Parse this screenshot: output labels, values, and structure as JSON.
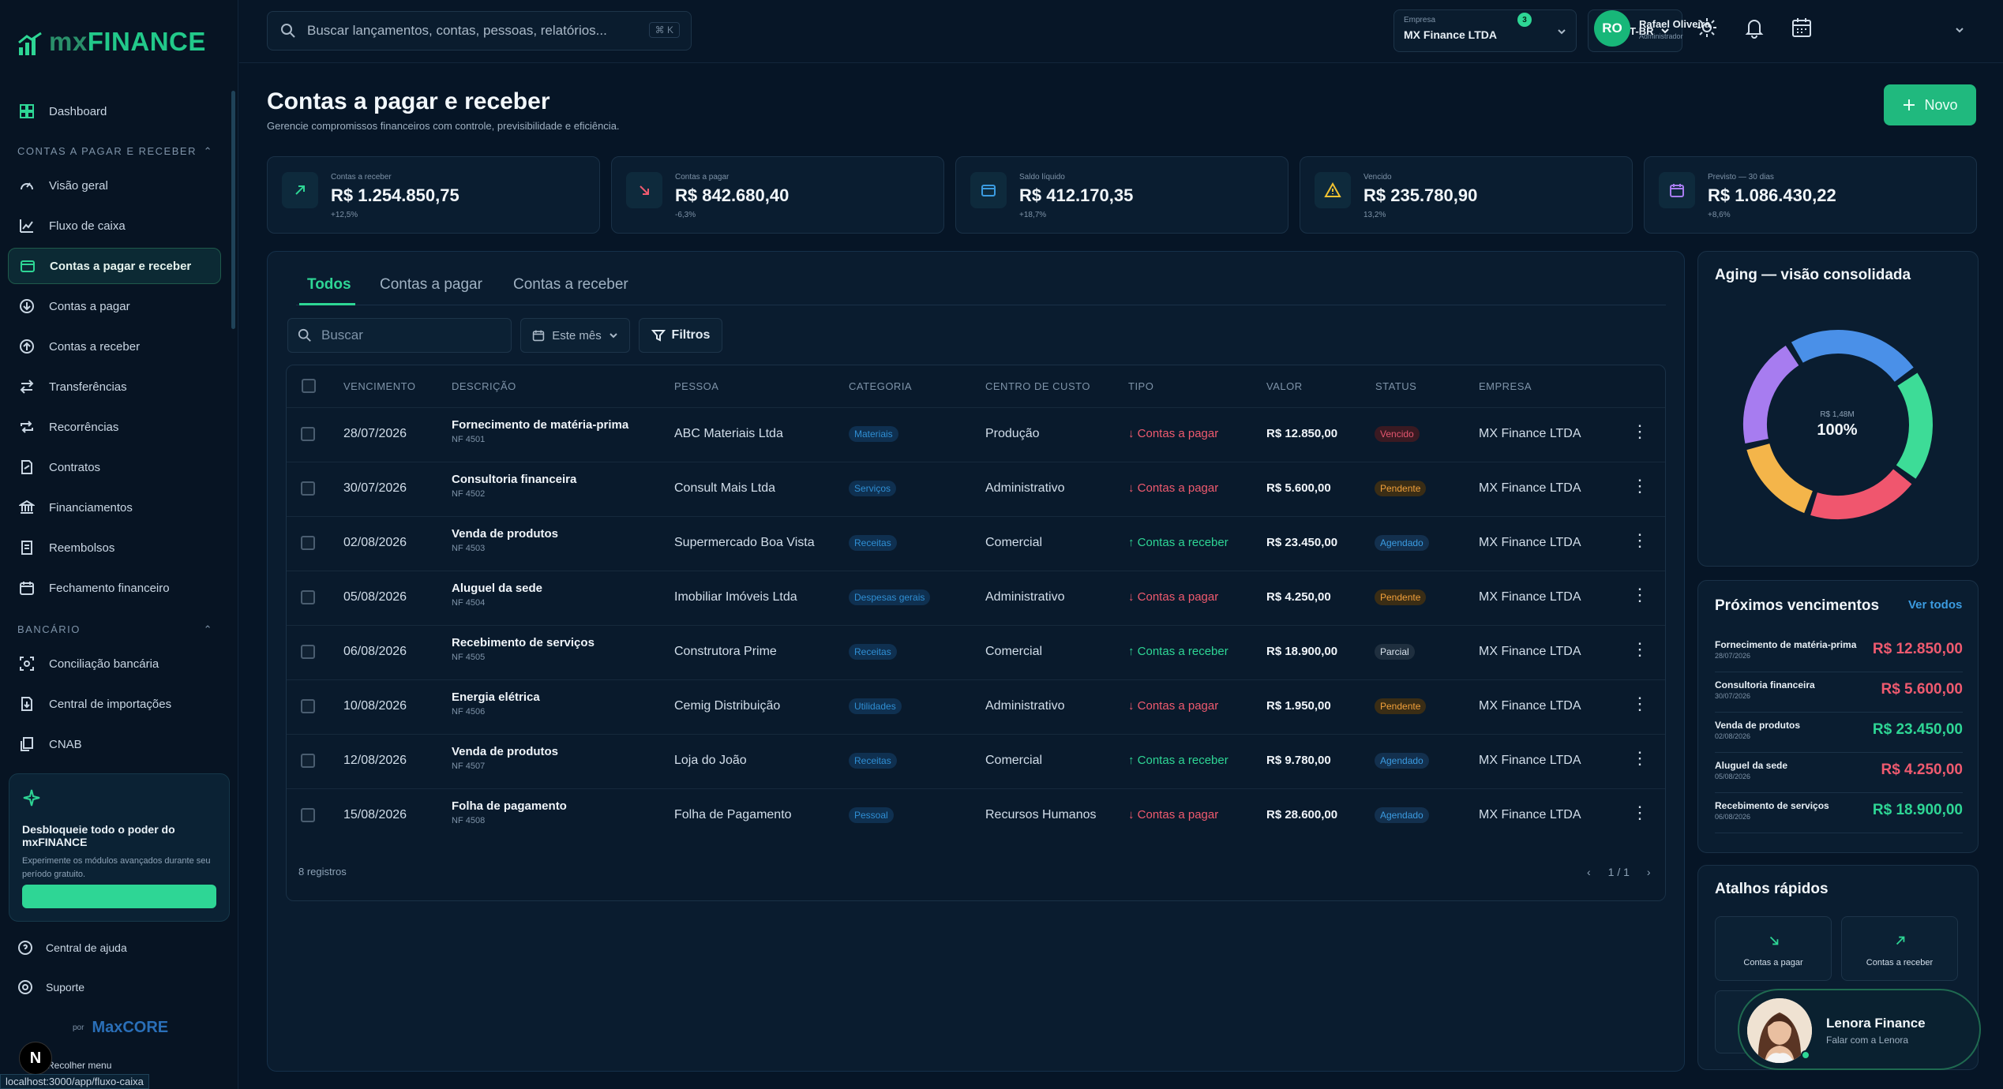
{
  "brand": {
    "logo_prefix": "mx",
    "logo_main": "FINANCE",
    "accent": "#2ed695"
  },
  "search": {
    "placeholder": "Buscar lançamentos, contas, pessoas, relatórios...",
    "shortcut": "⌘ K"
  },
  "topbar": {
    "company_label": "Empresa",
    "company_value": "MX Finance LTDA",
    "language": "PT-BR",
    "notification_count": "3",
    "user_initials": "RO",
    "user_name": "Rafael Oliveira",
    "user_role": "Administrador"
  },
  "sidebar": {
    "dashboard": "Dashboard",
    "section_contas": "CONTAS A PAGAR E RECEBER",
    "items": [
      {
        "label": "Visão geral",
        "icon": "gauge-icon"
      },
      {
        "label": "Fluxo de caixa",
        "icon": "chart-line-icon"
      },
      {
        "label": "Contas a pagar e receber",
        "icon": "wallet-icon",
        "active": true
      },
      {
        "label": "Contas a pagar",
        "icon": "arrow-down-circle-icon"
      },
      {
        "label": "Contas a receber",
        "icon": "arrow-up-circle-icon"
      },
      {
        "label": "Transferências",
        "icon": "transfer-icon"
      },
      {
        "label": "Recorrências",
        "icon": "repeat-icon"
      },
      {
        "label": "Contratos",
        "icon": "contract-icon"
      },
      {
        "label": "Financiamentos",
        "icon": "bank-icon"
      },
      {
        "label": "Reembolsos",
        "icon": "receipt-icon"
      },
      {
        "label": "Fechamento financeiro",
        "icon": "calendar-check-icon"
      }
    ],
    "section_bancario": "BANCÁRIO",
    "bank_items": [
      {
        "label": "Conciliação bancária",
        "icon": "scan-icon"
      },
      {
        "label": "Central de importações",
        "icon": "file-import-icon"
      },
      {
        "label": "CNAB",
        "icon": "files-icon"
      }
    ],
    "promo_title": "Desbloqueie todo o poder do mxFINANCE",
    "promo_text": "Experimente os módulos avançados durante seu período gratuito.",
    "help": "Central de ajuda",
    "support": "Suporte",
    "powered_by": "por",
    "powered_brand": "MaxCORE",
    "collapse": "Recolher menu"
  },
  "page": {
    "title": "Contas a pagar e receber",
    "subtitle": "Gerencie compromissos financeiros com controle, previsibilidade e eficiência.",
    "new_button": "Novo"
  },
  "kpis": [
    {
      "label": "Contas a receber",
      "value": "R$ 1.254.850,75",
      "delta": "+12,5%",
      "icon": "arrow-up-right-icon",
      "color": "#2ed695"
    },
    {
      "label": "Contas a pagar",
      "value": "R$ 842.680,40",
      "delta": "-6,3%",
      "icon": "arrow-down-right-icon",
      "color": "#ef5a6f"
    },
    {
      "label": "Saldo líquido",
      "value": "R$ 412.170,35",
      "delta": "+18,7%",
      "icon": "wallet-icon",
      "color": "#3b9be0"
    },
    {
      "label": "Vencido",
      "value": "R$ 235.780,90",
      "delta": "13,2%",
      "icon": "warning-icon",
      "color": "#f1c232"
    },
    {
      "label": "Previsto — 30 dias",
      "value": "R$ 1.086.430,22",
      "delta": "+8,6%",
      "icon": "calendar-icon",
      "color": "#a77cf0"
    }
  ],
  "tabs": [
    "Todos",
    "Contas a pagar",
    "Contas a receber"
  ],
  "filters": {
    "search_placeholder": "Buscar",
    "period": "Este mês",
    "filters_label": "Filtros"
  },
  "table": {
    "headers": [
      "VENCIMENTO",
      "DESCRIÇÃO",
      "PESSOA",
      "CATEGORIA",
      "CENTRO DE CUSTO",
      "TIPO",
      "VALOR",
      "STATUS",
      "EMPRESA"
    ],
    "rows": [
      {
        "date": "28/07/2026",
        "desc": "Fornecimento de matéria-prima",
        "nf": "NF 4501",
        "person": "ABC Materiais Ltda",
        "category": "Materiais",
        "center": "Produção",
        "type": "↓ Contas a pagar",
        "kind": "pay",
        "value": "R$ 12.850,00",
        "status": "Vencido",
        "st": "venc",
        "company": "MX Finance LTDA"
      },
      {
        "date": "30/07/2026",
        "desc": "Consultoria financeira",
        "nf": "NF 4502",
        "person": "Consult Mais Ltda",
        "category": "Serviços",
        "center": "Administrativo",
        "type": "↓ Contas a pagar",
        "kind": "pay",
        "value": "R$ 5.600,00",
        "status": "Pendente",
        "st": "pend",
        "company": "MX Finance LTDA"
      },
      {
        "date": "02/08/2026",
        "desc": "Venda de produtos",
        "nf": "NF 4503",
        "person": "Supermercado Boa Vista",
        "category": "Receitas",
        "center": "Comercial",
        "type": "↑ Contas a receber",
        "kind": "rec",
        "value": "R$ 23.450,00",
        "status": "Agendado",
        "st": "ag",
        "company": "MX Finance LTDA"
      },
      {
        "date": "05/08/2026",
        "desc": "Aluguel da sede",
        "nf": "NF 4504",
        "person": "Imobiliar Imóveis Ltda",
        "category": "Despesas gerais",
        "center": "Administrativo",
        "type": "↓ Contas a pagar",
        "kind": "pay",
        "value": "R$ 4.250,00",
        "status": "Pendente",
        "st": "pend",
        "company": "MX Finance LTDA"
      },
      {
        "date": "06/08/2026",
        "desc": "Recebimento de serviços",
        "nf": "NF 4505",
        "person": "Construtora Prime",
        "category": "Receitas",
        "center": "Comercial",
        "type": "↑ Contas a receber",
        "kind": "rec",
        "value": "R$ 18.900,00",
        "status": "Parcial",
        "st": "parc",
        "company": "MX Finance LTDA"
      },
      {
        "date": "10/08/2026",
        "desc": "Energia elétrica",
        "nf": "NF 4506",
        "person": "Cemig Distribuição",
        "category": "Utilidades",
        "center": "Administrativo",
        "type": "↓ Contas a pagar",
        "kind": "pay",
        "value": "R$ 1.950,00",
        "status": "Pendente",
        "st": "pend",
        "company": "MX Finance LTDA"
      },
      {
        "date": "12/08/2026",
        "desc": "Venda de produtos",
        "nf": "NF 4507",
        "person": "Loja do João",
        "category": "Receitas",
        "center": "Comercial",
        "type": "↑ Contas a receber",
        "kind": "rec",
        "value": "R$ 9.780,00",
        "status": "Agendado",
        "st": "ag",
        "company": "MX Finance LTDA"
      },
      {
        "date": "15/08/2026",
        "desc": "Folha de pagamento",
        "nf": "NF 4508",
        "person": "Folha de Pagamento",
        "category": "Pessoal",
        "center": "Recursos Humanos",
        "type": "↓ Contas a pagar",
        "kind": "pay",
        "value": "R$ 28.600,00",
        "status": "Agendado",
        "st": "ag",
        "company": "MX Finance LTDA"
      }
    ],
    "record_count": "8 registros",
    "page": "1 / 1"
  },
  "aging": {
    "title": "Aging — visão consolidada",
    "center_value": "R$ 1,48M",
    "center_percent": "100%",
    "segments": [
      {
        "color": "#4a90e8",
        "fraction": 0.24
      },
      {
        "color": "#3ddc97",
        "fraction": 0.2
      },
      {
        "color": "#f0566e",
        "fraction": 0.2
      },
      {
        "color": "#f4b54a",
        "fraction": 0.16
      },
      {
        "color": "#a77cf0",
        "fraction": 0.2
      }
    ]
  },
  "upcoming": {
    "title": "Próximos vencimentos",
    "link": "Ver todos",
    "items": [
      {
        "name": "Fornecimento de matéria-prima",
        "date": "28/07/2026",
        "value": "R$ 12.850,00",
        "kind": "pay"
      },
      {
        "name": "Consultoria financeira",
        "date": "30/07/2026",
        "value": "R$ 5.600,00",
        "kind": "pay"
      },
      {
        "name": "Venda de produtos",
        "date": "02/08/2026",
        "value": "R$ 23.450,00",
        "kind": "rec"
      },
      {
        "name": "Aluguel da sede",
        "date": "05/08/2026",
        "value": "R$ 4.250,00",
        "kind": "pay"
      },
      {
        "name": "Recebimento de serviços",
        "date": "06/08/2026",
        "value": "R$ 18.900,00",
        "kind": "rec"
      }
    ]
  },
  "shortcuts": {
    "title": "Atalhos rápidos",
    "pay": "Contas a pagar",
    "receive": "Contas a receber"
  },
  "assistant": {
    "name": "Lenora Finance",
    "cta": "Falar com a Lenora"
  },
  "status_url": "localhost:3000/app/fluxo-caixa",
  "devtools_badge": "N"
}
